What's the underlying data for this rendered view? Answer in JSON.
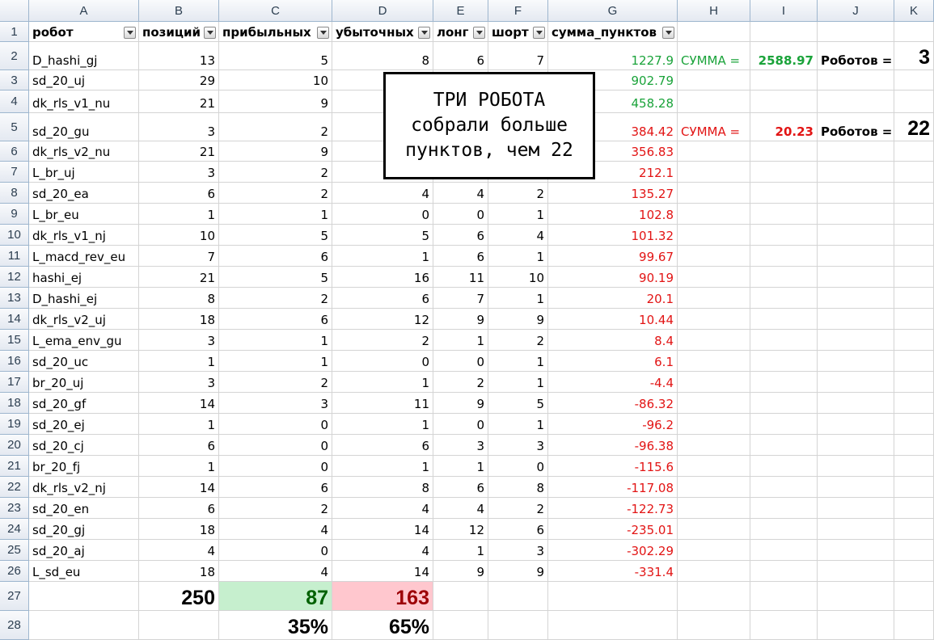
{
  "columns": [
    "A",
    "B",
    "C",
    "D",
    "E",
    "F",
    "G",
    "H",
    "I",
    "J",
    "K"
  ],
  "header_row": {
    "row_num": "1",
    "labels": [
      "робот",
      "позиций",
      "прибыльных",
      "убыточных",
      "лонг",
      "шорт",
      "сумма_пунктов"
    ]
  },
  "rows": [
    {
      "n": "2",
      "a": "D_hashi_gj",
      "b": "13",
      "c": "5",
      "d": "8",
      "e": "6",
      "f": "7",
      "g": "1227.9"
    },
    {
      "n": "3",
      "a": "sd_20_uj",
      "b": "29",
      "c": "10",
      "d": "",
      "e": "",
      "f": "",
      "g": "902.79"
    },
    {
      "n": "4",
      "a": "dk_rls_v1_nu",
      "b": "21",
      "c": "9",
      "d": "",
      "e": "",
      "f": "",
      "g": "458.28"
    },
    {
      "n": "5",
      "a": "sd_20_gu",
      "b": "3",
      "c": "2",
      "d": "",
      "e": "",
      "f": "",
      "g": "384.42"
    },
    {
      "n": "6",
      "a": "dk_rls_v2_nu",
      "b": "21",
      "c": "9",
      "d": "",
      "e": "",
      "f": "",
      "g": "356.83"
    },
    {
      "n": "7",
      "a": "L_br_uj",
      "b": "3",
      "c": "2",
      "d": "",
      "e": "",
      "f": "",
      "g": "212.1"
    },
    {
      "n": "8",
      "a": "sd_20_ea",
      "b": "6",
      "c": "2",
      "d": "4",
      "e": "4",
      "f": "2",
      "g": "135.27"
    },
    {
      "n": "9",
      "a": "L_br_eu",
      "b": "1",
      "c": "1",
      "d": "0",
      "e": "0",
      "f": "1",
      "g": "102.8"
    },
    {
      "n": "10",
      "a": "dk_rls_v1_nj",
      "b": "10",
      "c": "5",
      "d": "5",
      "e": "6",
      "f": "4",
      "g": "101.32"
    },
    {
      "n": "11",
      "a": "L_macd_rev_eu",
      "b": "7",
      "c": "6",
      "d": "1",
      "e": "6",
      "f": "1",
      "g": "99.67"
    },
    {
      "n": "12",
      "a": "hashi_ej",
      "b": "21",
      "c": "5",
      "d": "16",
      "e": "11",
      "f": "10",
      "g": "90.19"
    },
    {
      "n": "13",
      "a": "D_hashi_ej",
      "b": "8",
      "c": "2",
      "d": "6",
      "e": "7",
      "f": "1",
      "g": "20.1"
    },
    {
      "n": "14",
      "a": "dk_rls_v2_uj",
      "b": "18",
      "c": "6",
      "d": "12",
      "e": "9",
      "f": "9",
      "g": "10.44"
    },
    {
      "n": "15",
      "a": "L_ema_env_gu",
      "b": "3",
      "c": "1",
      "d": "2",
      "e": "1",
      "f": "2",
      "g": "8.4"
    },
    {
      "n": "16",
      "a": "sd_20_uc",
      "b": "1",
      "c": "1",
      "d": "0",
      "e": "0",
      "f": "1",
      "g": "6.1"
    },
    {
      "n": "17",
      "a": "br_20_uj",
      "b": "3",
      "c": "2",
      "d": "1",
      "e": "2",
      "f": "1",
      "g": "-4.4"
    },
    {
      "n": "18",
      "a": "sd_20_gf",
      "b": "14",
      "c": "3",
      "d": "11",
      "e": "9",
      "f": "5",
      "g": "-86.32"
    },
    {
      "n": "19",
      "a": "sd_20_ej",
      "b": "1",
      "c": "0",
      "d": "1",
      "e": "0",
      "f": "1",
      "g": "-96.2"
    },
    {
      "n": "20",
      "a": "sd_20_cj",
      "b": "6",
      "c": "0",
      "d": "6",
      "e": "3",
      "f": "3",
      "g": "-96.38"
    },
    {
      "n": "21",
      "a": "br_20_fj",
      "b": "1",
      "c": "0",
      "d": "1",
      "e": "1",
      "f": "0",
      "g": "-115.6"
    },
    {
      "n": "22",
      "a": "dk_rls_v2_nj",
      "b": "14",
      "c": "6",
      "d": "8",
      "e": "6",
      "f": "8",
      "g": "-117.08"
    },
    {
      "n": "23",
      "a": "sd_20_en",
      "b": "6",
      "c": "2",
      "d": "4",
      "e": "4",
      "f": "2",
      "g": "-122.73"
    },
    {
      "n": "24",
      "a": "sd_20_gj",
      "b": "18",
      "c": "4",
      "d": "14",
      "e": "12",
      "f": "6",
      "g": "-235.01"
    },
    {
      "n": "25",
      "a": "sd_20_aj",
      "b": "4",
      "c": "0",
      "d": "4",
      "e": "1",
      "f": "3",
      "g": "-302.29"
    },
    {
      "n": "26",
      "a": "L_sd_eu",
      "b": "18",
      "c": "4",
      "d": "14",
      "e": "9",
      "f": "9",
      "g": "-331.4"
    }
  ],
  "totals": {
    "row_num": "27",
    "positions": "250",
    "profitable": "87",
    "losing": "163"
  },
  "percents": {
    "row_num": "28",
    "profitable": "35%",
    "losing": "65%"
  },
  "summary": {
    "profit_label": "СУММА =",
    "profit_sum": "2588.97",
    "profit_robots_label": "Роботов =",
    "profit_robots": "3",
    "loss_label": "СУММА =",
    "loss_sum": "20.23",
    "loss_robots_label": "Роботов =",
    "loss_robots": "22"
  },
  "callout": {
    "line1": "ТРИ РОБОТА",
    "line2": "собрали больше",
    "line3": "пунктов, чем 22"
  },
  "colors": {
    "profit_text": "#1aa33a",
    "loss_text": "#e21414",
    "green_fill": "#c6efce",
    "green_text": "#006100",
    "red_fill": "#ffc7ce",
    "red_text": "#9c0006"
  }
}
